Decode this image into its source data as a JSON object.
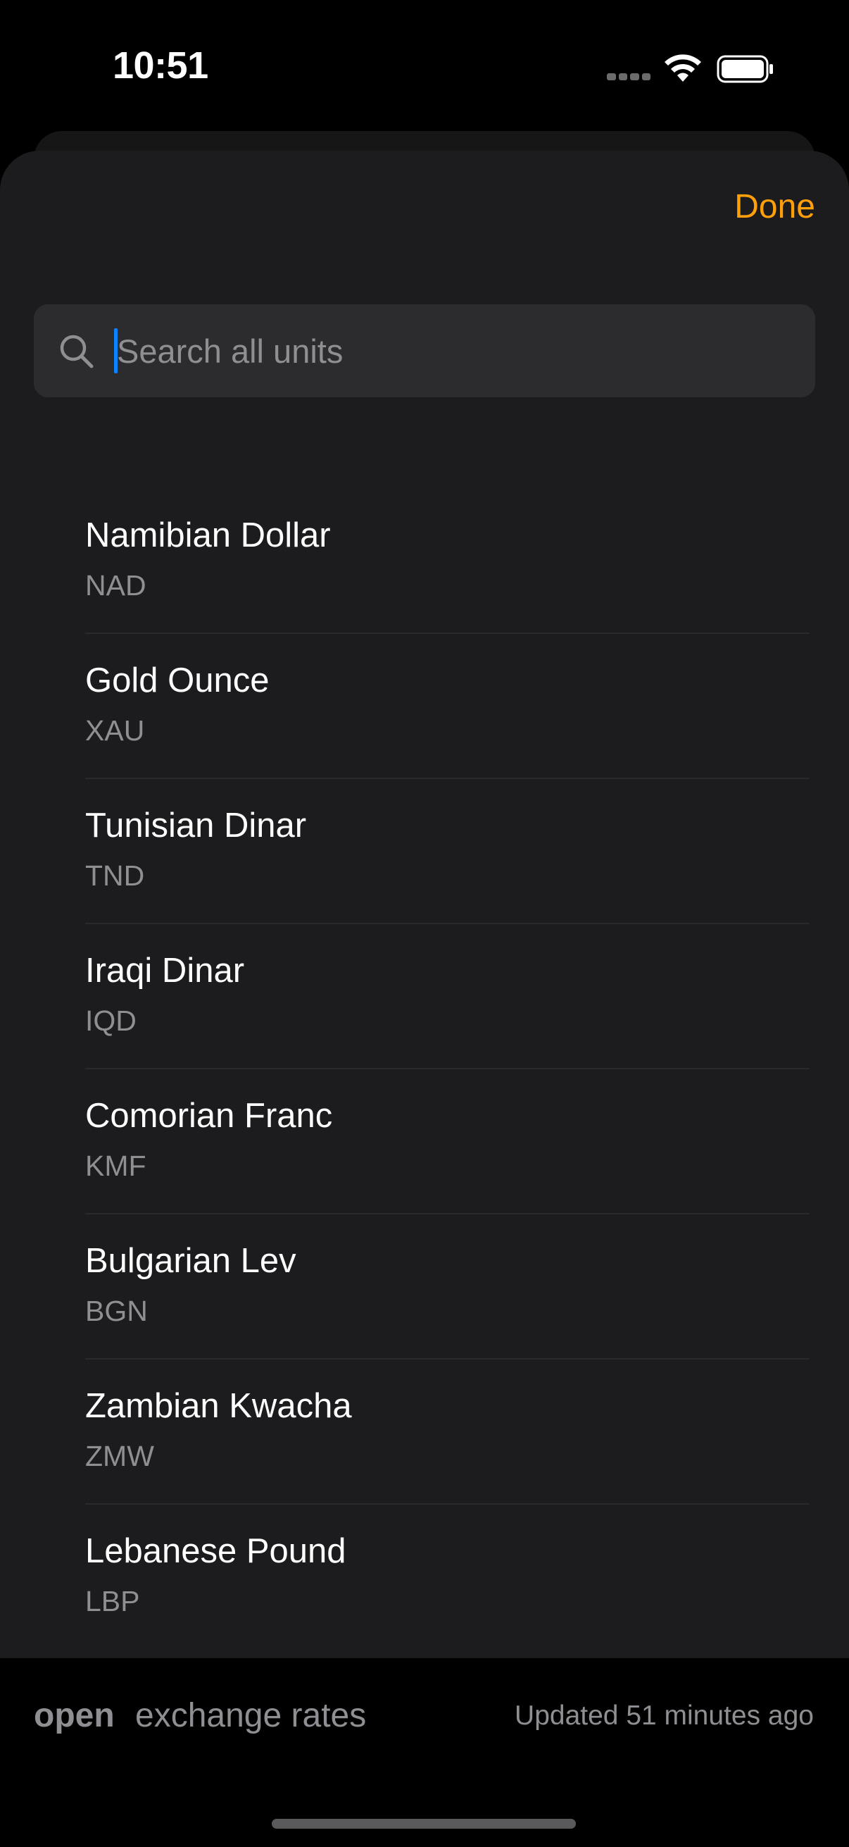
{
  "status_bar": {
    "time": "10:51"
  },
  "sheet": {
    "done_label": "Done",
    "accent_color": "#ff9f0a",
    "search": {
      "placeholder": "Search all units",
      "value": ""
    },
    "units": [
      {
        "name": "Namibian Dollar",
        "code": "NAD"
      },
      {
        "name": "Gold Ounce",
        "code": "XAU"
      },
      {
        "name": "Tunisian Dinar",
        "code": "TND"
      },
      {
        "name": "Iraqi Dinar",
        "code": "IQD"
      },
      {
        "name": "Comorian Franc",
        "code": "KMF"
      },
      {
        "name": "Bulgarian Lev",
        "code": "BGN"
      },
      {
        "name": "Zambian Kwacha",
        "code": "ZMW"
      },
      {
        "name": "Lebanese Pound",
        "code": "LBP"
      }
    ]
  },
  "footer": {
    "brand_open": "open",
    "brand_rest": "exchange rates",
    "updated_text": "Updated 51 minutes ago"
  },
  "icons": [
    "search-icon",
    "wifi-icon",
    "battery-icon",
    "cellular-signal-icon"
  ]
}
